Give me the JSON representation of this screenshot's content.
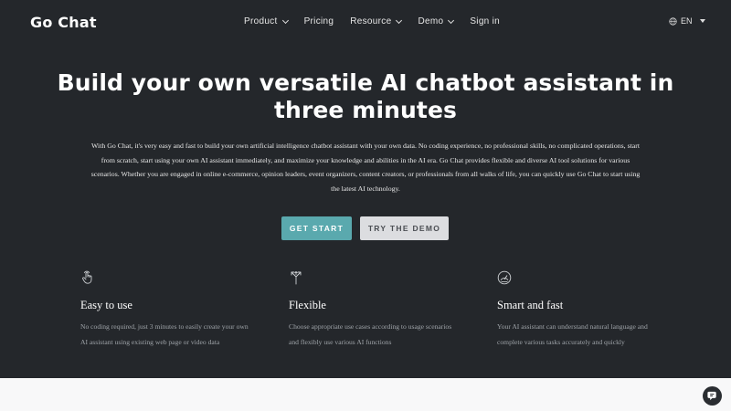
{
  "brand": {
    "logo_text": "Go Chat"
  },
  "nav": {
    "items": [
      {
        "label": "Product",
        "has_dropdown": true
      },
      {
        "label": "Pricing",
        "has_dropdown": false
      },
      {
        "label": "Resource",
        "has_dropdown": true
      },
      {
        "label": "Demo",
        "has_dropdown": true
      },
      {
        "label": "Sign in",
        "has_dropdown": false
      }
    ],
    "language": {
      "label": "EN",
      "icon": "globe-icon"
    }
  },
  "hero": {
    "title_line1": "Build your own versatile AI chatbot assistant in",
    "title_line2": "three minutes",
    "description": "With Go Chat, it's very easy and fast to build your own artificial intelligence chatbot assistant with your own data. No coding experience, no professional skills, no complicated operations, start from scratch, start using your own AI assistant immediately, and maximize your knowledge and abilities in the AI era. Go Chat provides flexible and diverse AI tool solutions for various scenarios. Whether you are engaged in online e-commerce, opinion leaders, event organizers, content creators, or professionals from all walks of life, you can quickly use Go Chat to start using the latest AI technology.",
    "primary_button": "GET START",
    "secondary_button": "TRY THE DEMO"
  },
  "features": [
    {
      "icon": "hand-pointer-icon",
      "title": "Easy to use",
      "description": "No coding required, just 3 minutes to easily create your own AI assistant using existing web page or video data"
    },
    {
      "icon": "arrows-split-icon",
      "title": "Flexible",
      "description": "Choose appropriate use cases according to usage scenarios and flexibly use various AI functions"
    },
    {
      "icon": "gauge-icon",
      "title": "Smart and fast",
      "description": "Your AI assistant can understand natural language and complete various tasks accurately and quickly"
    }
  ],
  "colors": {
    "background": "#24272b",
    "accent": "#5aa9ae",
    "secondary_button": "#dcdde0",
    "footer_band": "#f8f8f9"
  },
  "chat_widget": {
    "icon": "chat-logo-icon"
  }
}
